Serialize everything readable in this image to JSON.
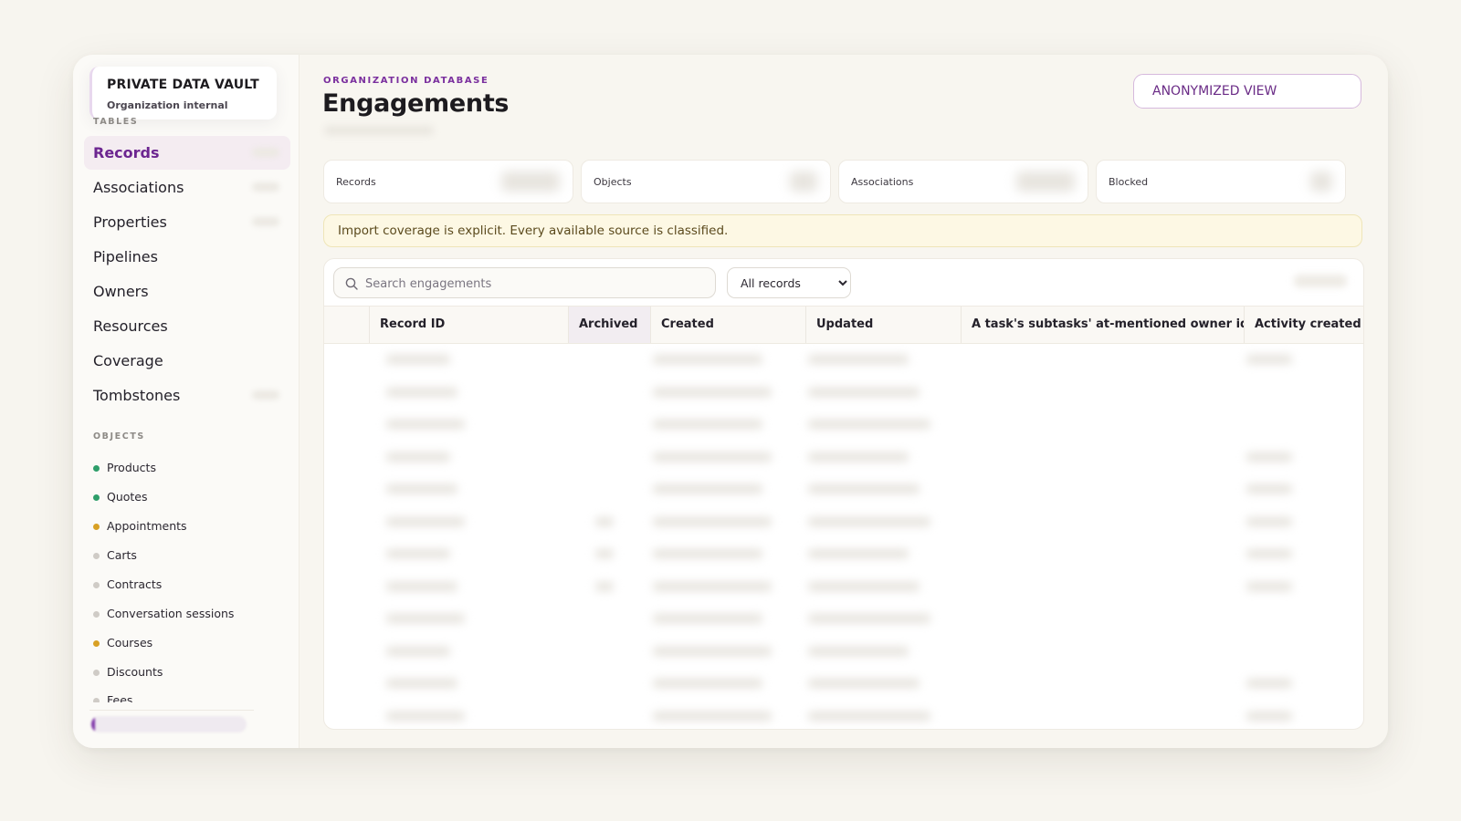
{
  "sidebar": {
    "vault_title": "PRIVATE DATA VAULT",
    "vault_subtitle": "Organization internal",
    "tables_label": "TABLES",
    "tables": [
      {
        "label": "Records",
        "active": true
      },
      {
        "label": "Associations"
      },
      {
        "label": "Properties"
      },
      {
        "label": "Pipelines"
      },
      {
        "label": "Owners"
      },
      {
        "label": "Resources"
      },
      {
        "label": "Coverage"
      },
      {
        "label": "Tombstones"
      }
    ],
    "objects_label": "OBJECTS",
    "objects": [
      {
        "label": "Products",
        "color": "#2e9e6a"
      },
      {
        "label": "Quotes",
        "color": "#2e9e6a"
      },
      {
        "label": "Appointments",
        "color": "#d8a024"
      },
      {
        "label": "Carts",
        "color": "#cfcbc6"
      },
      {
        "label": "Contracts",
        "color": "#cfcbc6"
      },
      {
        "label": "Conversation sessions",
        "color": "#cfcbc6"
      },
      {
        "label": "Courses",
        "color": "#d8a024"
      },
      {
        "label": "Discounts",
        "color": "#cfcbc6"
      },
      {
        "label": "Fees",
        "color": "#cfcbc6"
      }
    ]
  },
  "header": {
    "eyebrow": "ORGANIZATION DATABASE",
    "title": "Engagements",
    "anonymized_button": "ANONYMIZED VIEW"
  },
  "stats": [
    {
      "label": "Records"
    },
    {
      "label": "Objects"
    },
    {
      "label": "Associations"
    },
    {
      "label": "Blocked"
    }
  ],
  "notice": "Import coverage is explicit. Every available source is classified.",
  "table": {
    "search_placeholder": "Search engagements",
    "filter_selected": "All records",
    "columns": [
      "Record ID",
      "Archived",
      "Created",
      "Updated",
      "A task's subtasks' at-mentioned owner ids",
      "Activity created by"
    ]
  },
  "colors": {
    "accent": "#6c2590",
    "notice_bg": "#fdf8e4",
    "active_nav_bg": "#f4ecf1"
  }
}
